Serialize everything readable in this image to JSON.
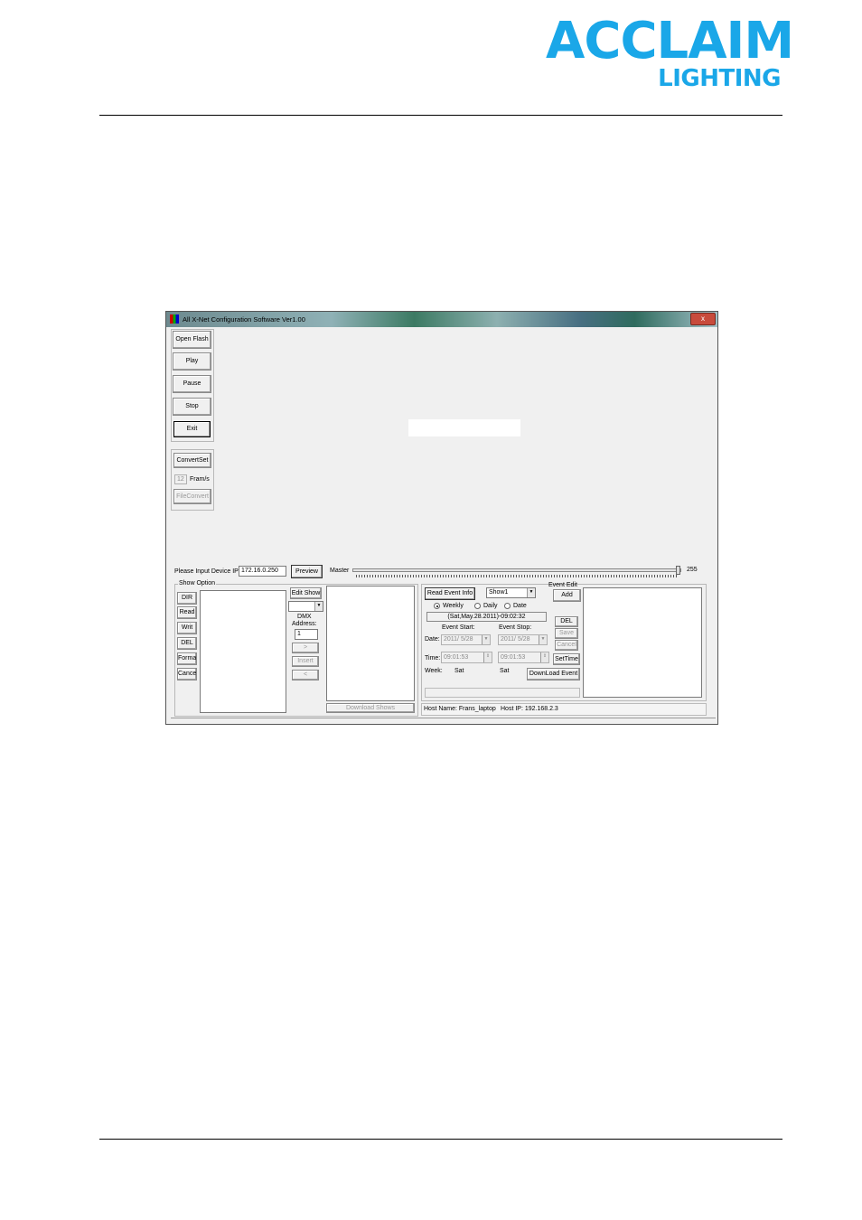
{
  "header": {
    "logo_line1": "ACCLAIM",
    "logo_line2": "LIGHTING",
    "brand_color": "#1aa7e8"
  },
  "window": {
    "title": "All X-Net Configuration Software Ver1.00",
    "close_glyph": "x",
    "left_buttons": {
      "open_flash": "Open Flash",
      "play": "Play",
      "pause": "Pause",
      "stop": "Stop",
      "exit": "Exit"
    },
    "convert": {
      "convert_set": "ConvertSet",
      "frame_value": "12",
      "frame_unit": "Fram/s",
      "file_convert": "FileConvert"
    },
    "device_ip_label": "Please Input Device IP:",
    "device_ip": "172.16.0.250",
    "preview": "Preview",
    "master_label": "Master",
    "master_value": "255",
    "master_level": 1.0,
    "show_option": {
      "title": "Show Option",
      "buttons": {
        "dir": "DIR",
        "read": "Read",
        "writ": "Writ",
        "del": "DEL",
        "format": "Format",
        "cancel": "Cancel"
      },
      "edit_show": "Edit Show",
      "dmx_label": "DMX\nAddress:",
      "dmx_value": "1",
      "arrow_right": ">",
      "insert": "Insert",
      "arrow_left": "<",
      "download_shows": "Download Shows"
    },
    "event": {
      "read_event_info": "Read Event Info",
      "show_select": "Show1",
      "event_edit_label": "Event Edit",
      "add": "Add",
      "radio_weekly": "Weekly",
      "radio_daily": "Daily",
      "radio_date": "Date",
      "current_datetime": "(Sat,May.28.2011)-09:02:32",
      "event_start": "Event Start:",
      "event_stop": "Event Stop:",
      "date_label": "Date:",
      "date_start": "2011/ 5/28",
      "date_stop": "2011/ 5/28",
      "time_label": "Time:",
      "time_start": "09:01:53",
      "time_stop": "09:01:53",
      "week_label": "Week:",
      "week_start": "Sat",
      "week_stop": "Sat",
      "del": "DEL",
      "save": "Save",
      "cancel": "Cancel",
      "set_time": "SetTime",
      "download_event": "DownLoad Event"
    },
    "status": {
      "host_name": "Host Name: Frans_laptop",
      "host_ip": "Host IP: 192.168.2.3"
    }
  }
}
